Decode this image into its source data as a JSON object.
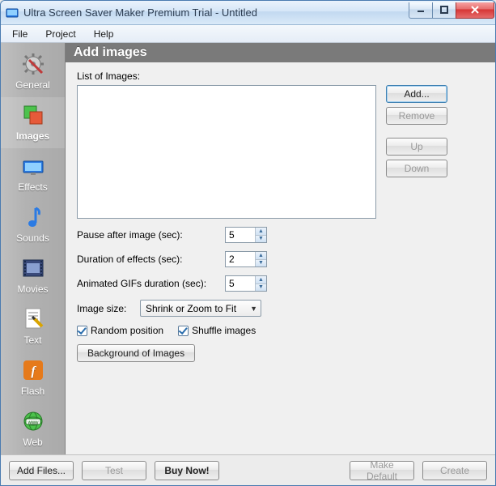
{
  "window": {
    "title": "Ultra Screen Saver Maker Premium Trial - Untitled"
  },
  "menu": {
    "file": "File",
    "project": "Project",
    "help": "Help"
  },
  "sidebar": {
    "items": [
      {
        "id": "general",
        "label": "General"
      },
      {
        "id": "images",
        "label": "Images"
      },
      {
        "id": "effects",
        "label": "Effects"
      },
      {
        "id": "sounds",
        "label": "Sounds"
      },
      {
        "id": "movies",
        "label": "Movies"
      },
      {
        "id": "text",
        "label": "Text"
      },
      {
        "id": "flash",
        "label": "Flash"
      },
      {
        "id": "web",
        "label": "Web"
      }
    ],
    "active": "images"
  },
  "panel": {
    "title": "Add images",
    "list_label": "List of Images:",
    "buttons": {
      "add": "Add...",
      "remove": "Remove",
      "up": "Up",
      "down": "Down"
    },
    "fields": {
      "pause_label": "Pause after image (sec):",
      "pause_value": "5",
      "duration_label": "Duration of effects (sec):",
      "duration_value": "2",
      "gif_label": "Animated GIFs duration (sec):",
      "gif_value": "5",
      "size_label": "Image size:",
      "size_value": "Shrink or Zoom to Fit"
    },
    "checks": {
      "random_label": "Random position",
      "random_checked": true,
      "shuffle_label": "Shuffle images",
      "shuffle_checked": true
    },
    "bg_button": "Background of Images"
  },
  "footer": {
    "add_files": "Add Files...",
    "test": "Test",
    "buy_now": "Buy Now!",
    "make_default": "Make Default",
    "create": "Create"
  }
}
